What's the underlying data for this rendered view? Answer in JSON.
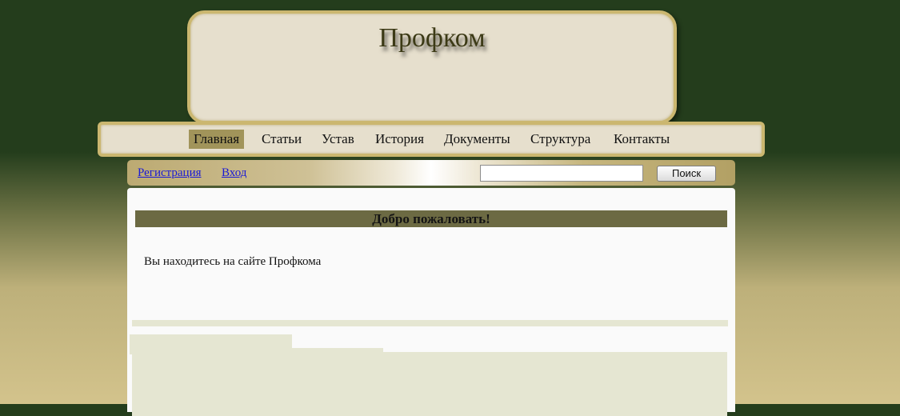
{
  "header": {
    "site_title": "Профком"
  },
  "nav": {
    "items": [
      {
        "label": "Главная",
        "active": true
      },
      {
        "label": "Статьи",
        "active": false
      },
      {
        "label": "Устав",
        "active": false
      },
      {
        "label": "История",
        "active": false
      },
      {
        "label": "Документы",
        "active": false
      },
      {
        "label": "Структура",
        "active": false
      },
      {
        "label": "Контакты",
        "active": false
      }
    ]
  },
  "userbar": {
    "register_label": "Регистрация",
    "login_label": "Вход",
    "search_value": "",
    "search_button_label": "Поиск"
  },
  "content": {
    "welcome_heading": "Добро пожаловать!",
    "welcome_text": "Вы находитесь на сайте Профкома"
  },
  "colors": {
    "background_dark": "#243d1c",
    "background_light": "#d3c38c",
    "panel": "#e6dfcd",
    "panel_border": "#cbb770",
    "nav_active": "#a1945a",
    "welcome_bar": "#6c6a43",
    "link": "#1a1ad6"
  }
}
